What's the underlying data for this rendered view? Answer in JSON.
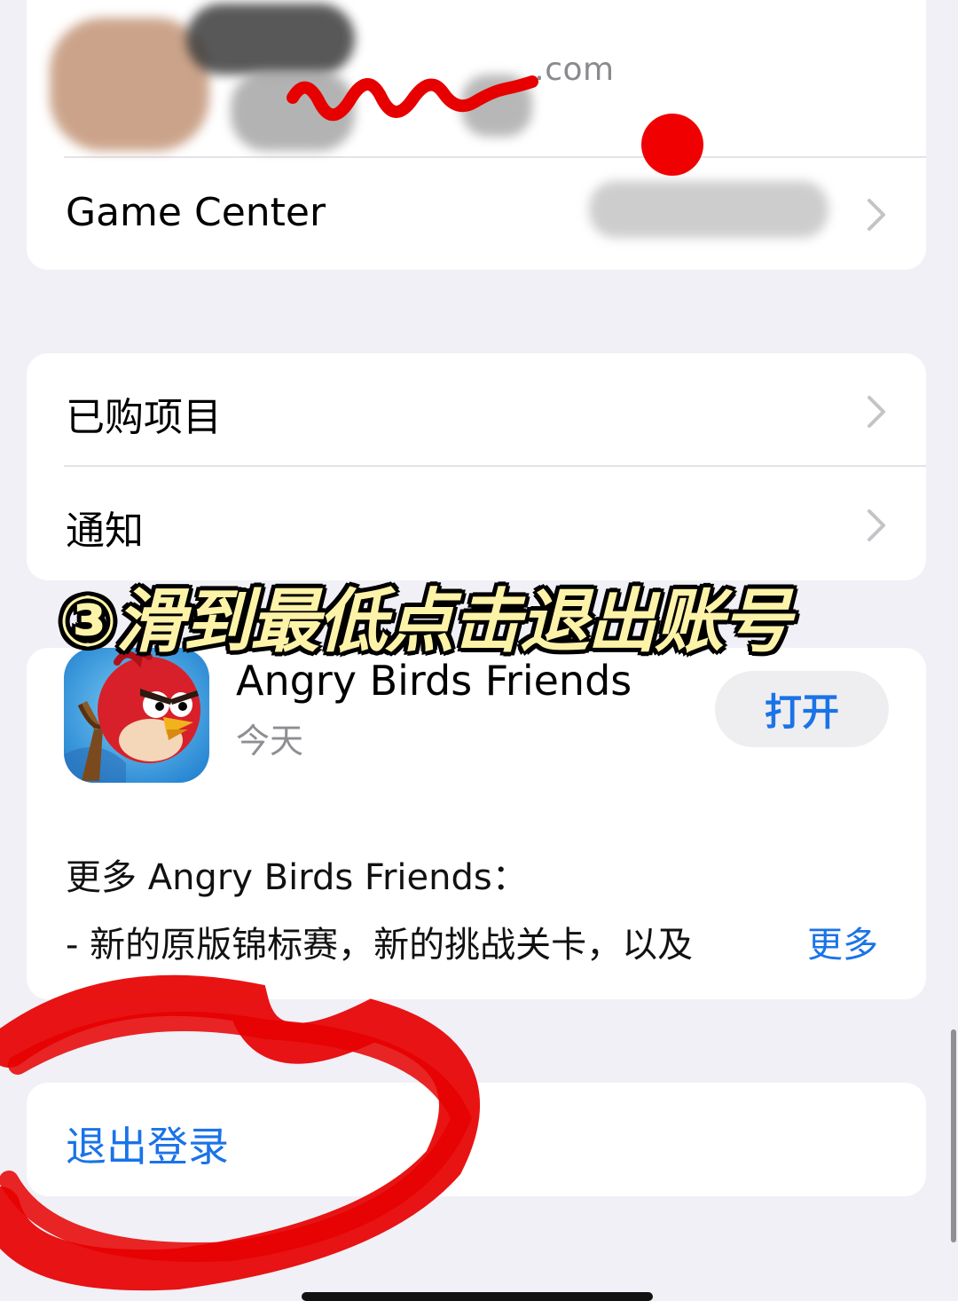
{
  "account": {
    "email_suffix": ".com",
    "game_center_label": "Game Center"
  },
  "menu": {
    "items": [
      {
        "label": "已购项目"
      },
      {
        "label": "通知"
      }
    ]
  },
  "overlay": {
    "caption": "③滑到最低点击退出账号"
  },
  "app_update": {
    "name": "Angry Birds Friends",
    "date": "今天",
    "open_button": "打开",
    "description_heading": "更多 Angry Birds Friends：",
    "description_line": "- 新的原版锦标赛，新的挑战关卡，以及",
    "more_link": "更多"
  },
  "sign_out": {
    "label": "退出登录"
  },
  "colors": {
    "accent_blue": "#1a73e8",
    "annotation_red": "#e60000",
    "caption_fill": "#fdf3a8",
    "background": "#f0f0f6"
  },
  "icons": [
    "chevron-right-icon",
    "angry-birds-app-icon"
  ]
}
